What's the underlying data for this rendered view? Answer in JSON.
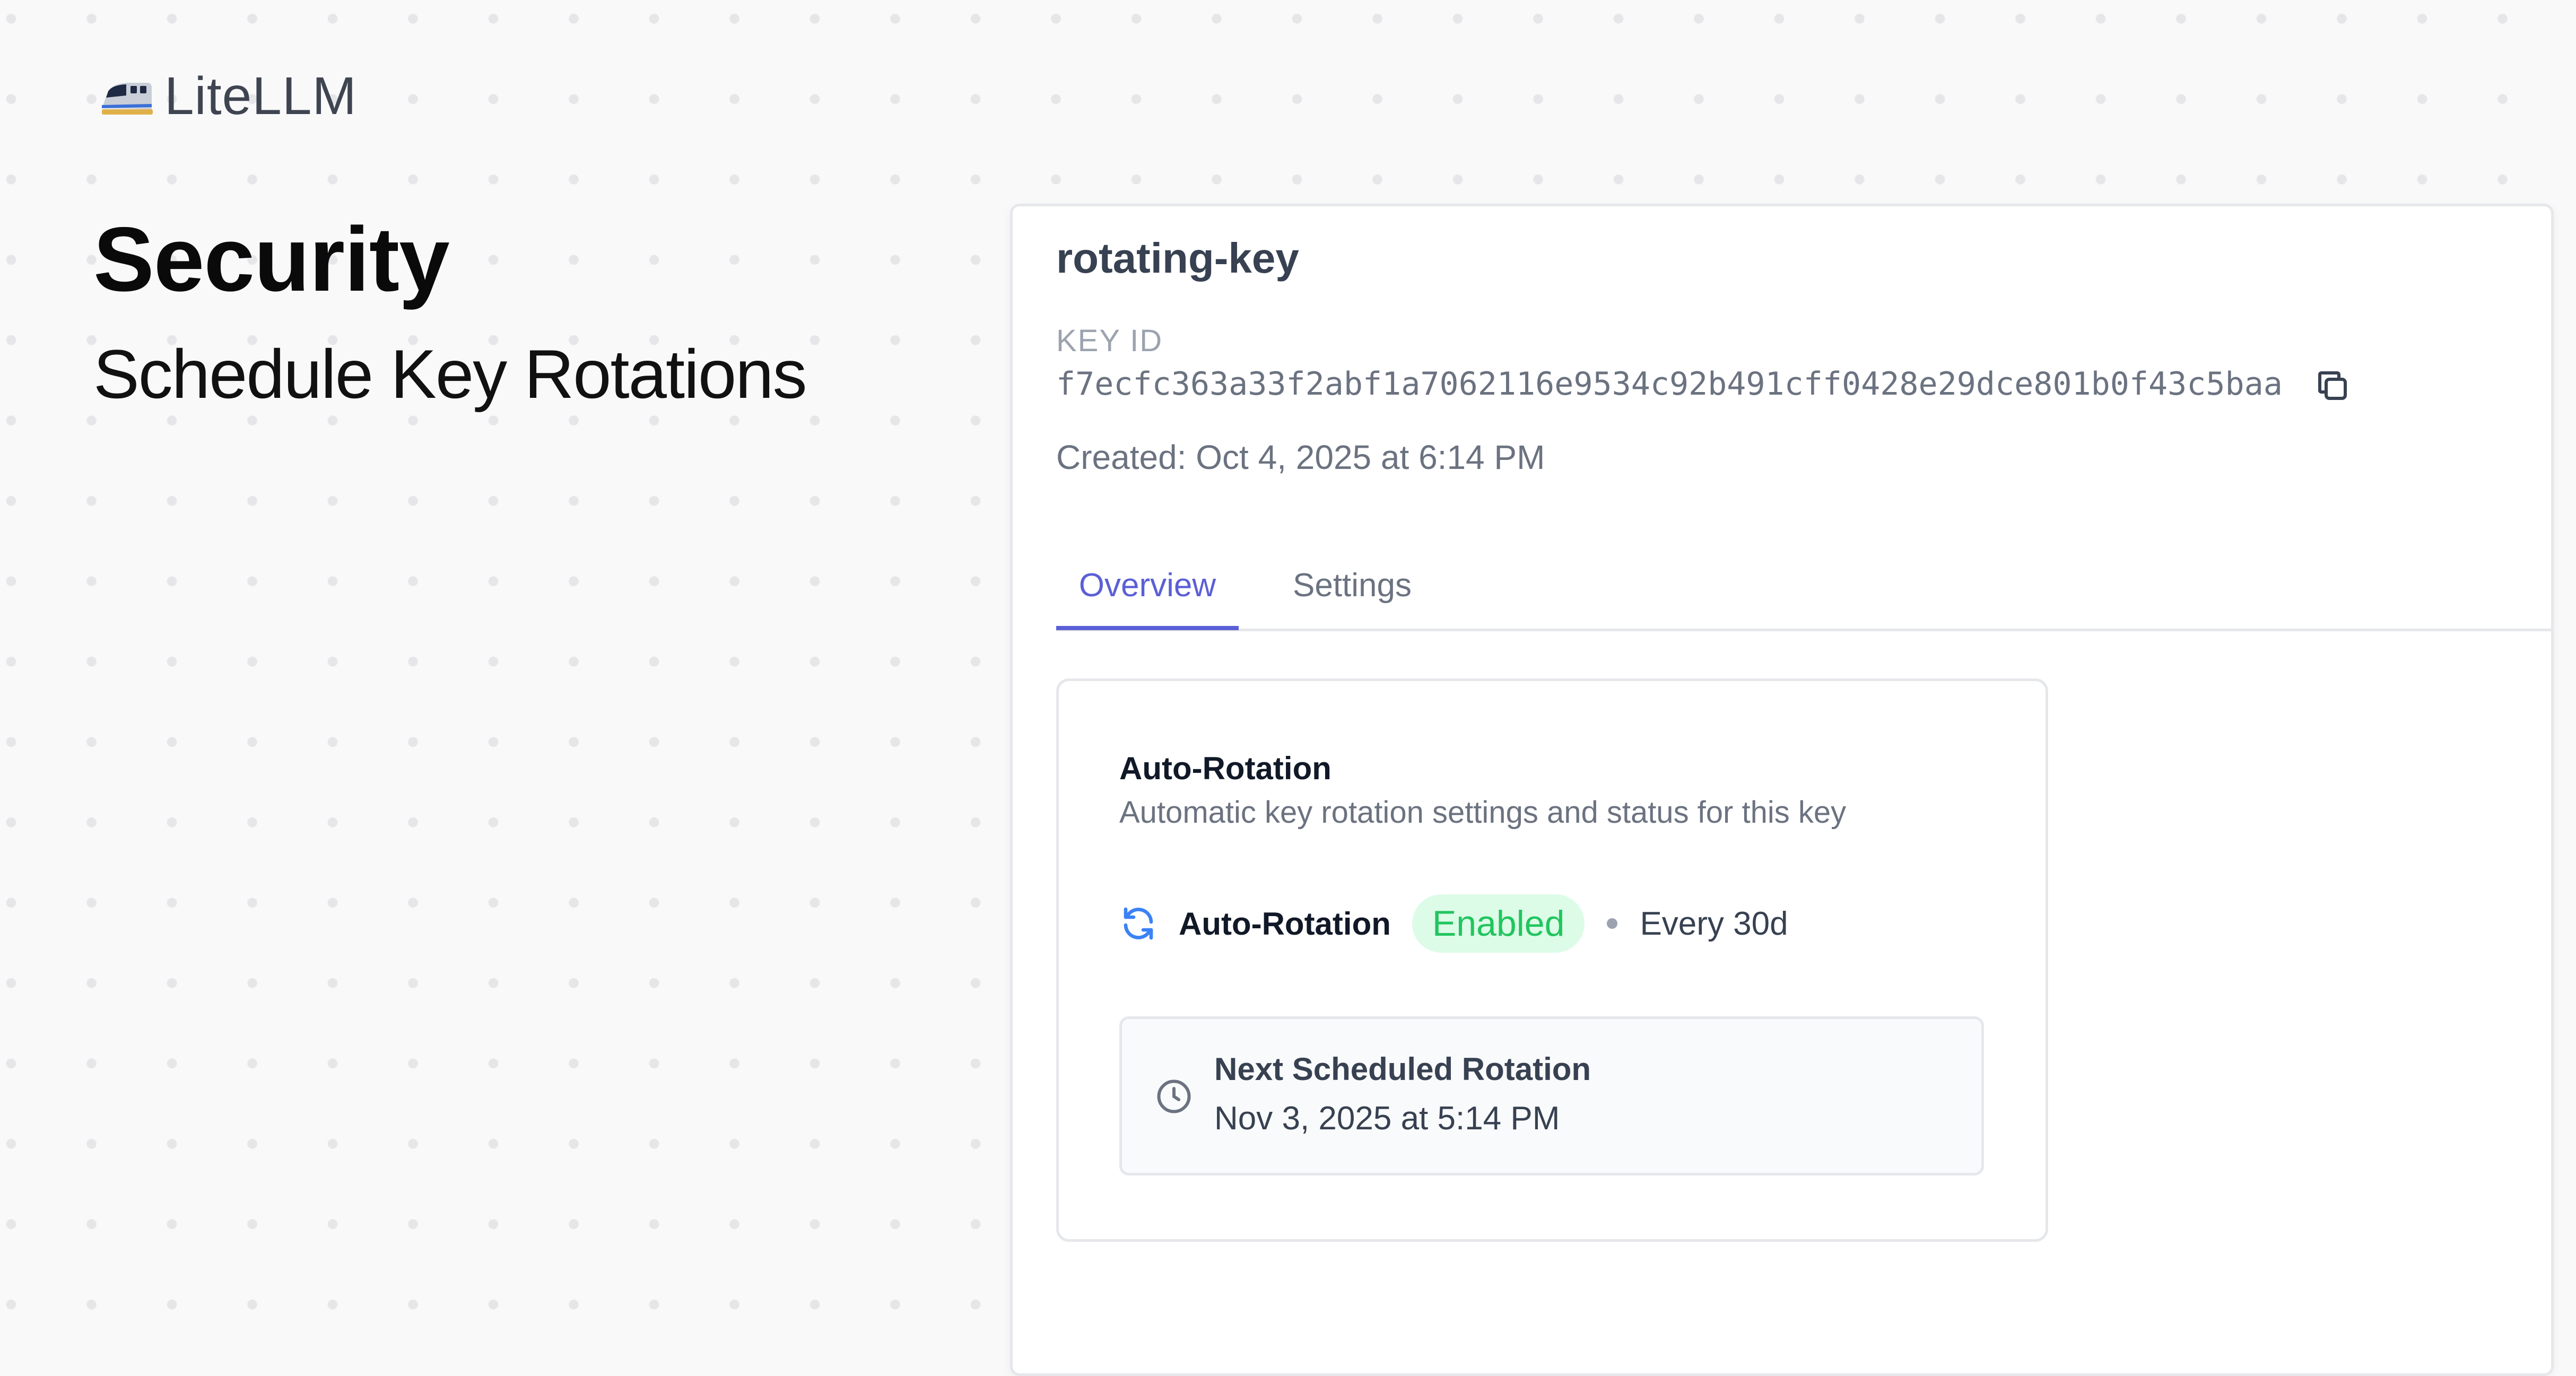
{
  "brand": {
    "name": "LiteLLM",
    "logo_icon": "bullet-train-icon"
  },
  "hero": {
    "title": "Security",
    "subtitle": "Schedule Key Rotations"
  },
  "key": {
    "name": "rotating-key",
    "id_label": "KEY ID",
    "id_value": "f7ecfc363a33f2abf1a7062116e9534c92b491cff0428e29dce801b0f43c5baa",
    "created": "Created: Oct 4, 2025 at 6:14 PM",
    "copy_icon": "copy-icon"
  },
  "tabs": [
    {
      "label": "Overview",
      "active": true
    },
    {
      "label": "Settings",
      "active": false
    }
  ],
  "auto_rotation": {
    "title": "Auto-Rotation",
    "description": "Automatic key rotation settings and status for this key",
    "status_label": "Auto-Rotation",
    "status_icon": "refresh-icon",
    "status_badge": "Enabled",
    "frequency": "Every 30d",
    "next_rotation": {
      "icon": "clock-icon",
      "title": "Next Scheduled Rotation",
      "date": "Nov 3, 2025 at 5:14 PM"
    }
  },
  "colors": {
    "accent": "#5b5fd6",
    "badge_bg": "#dcfce7",
    "badge_text": "#22c55e",
    "rotation_icon": "#3b82f6"
  }
}
